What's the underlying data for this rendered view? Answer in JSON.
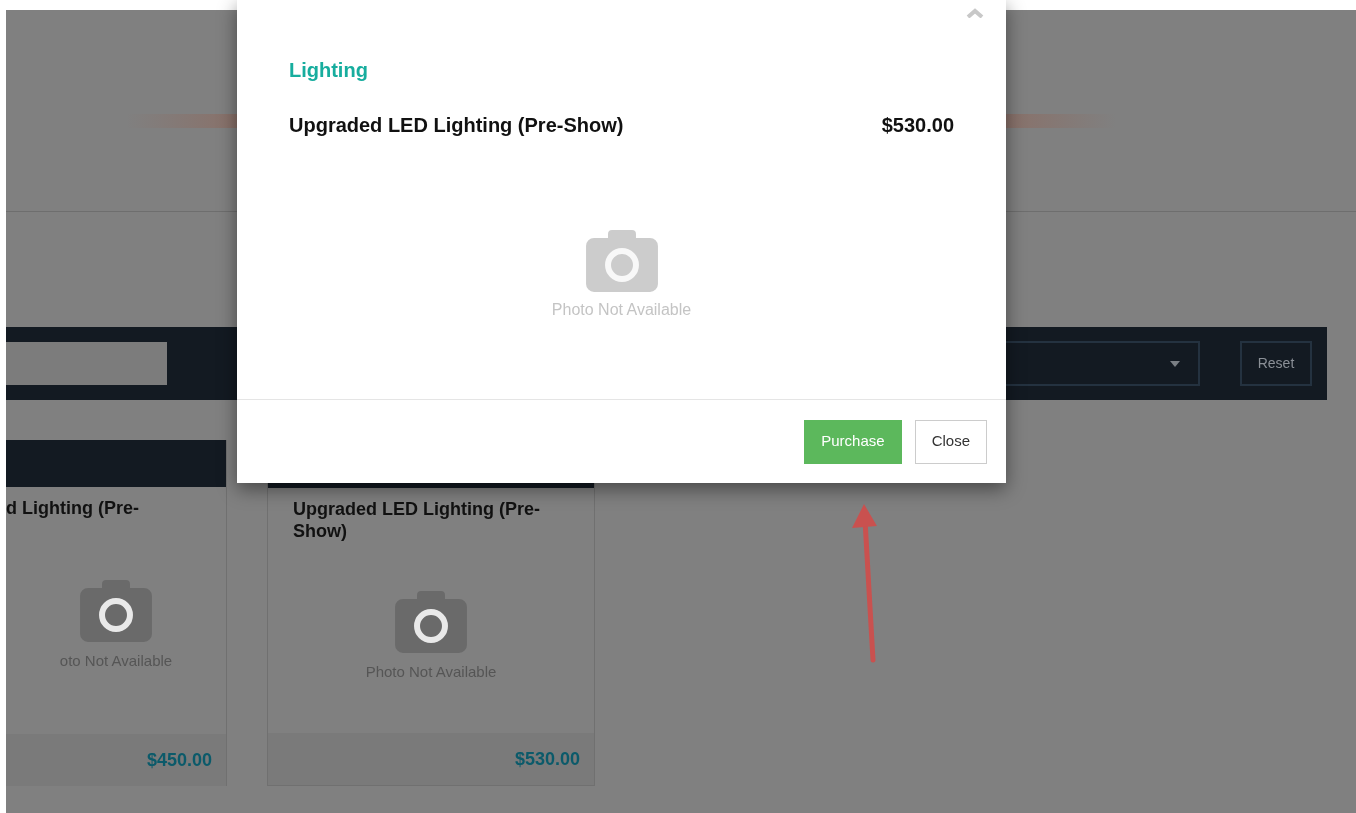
{
  "modal": {
    "category": "Lighting",
    "item_name": "Upgraded LED Lighting (Pre-Show)",
    "price": "$530.00",
    "photo_caption": "Photo Not Available",
    "buttons": [
      {
        "kind": "primary",
        "label": "Purchase"
      },
      {
        "kind": "secondary",
        "label": "Close"
      }
    ]
  },
  "filter_bar": {
    "button": "Reset"
  },
  "cards": [
    {
      "title": "d Lighting (Pre-",
      "photo_caption": "oto Not Available",
      "price": "$450.00"
    },
    {
      "title": "Upgraded LED Lighting (Pre-Show)",
      "photo_caption": "Photo Not Available",
      "price": "$530.00"
    }
  ]
}
